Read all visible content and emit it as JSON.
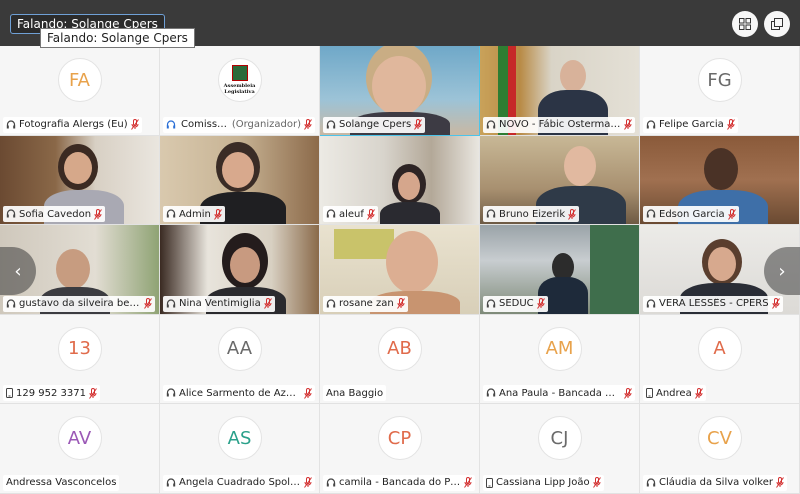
{
  "topbar": {
    "speaking": "Falando: Solange Cpers",
    "tooltip": "Falando: Solange Cpers"
  },
  "nav": {
    "prev_icon": "chevron-left-icon",
    "next_icon": "chevron-right-icon"
  },
  "colors": {
    "active_border": "#4cc4ea",
    "mic_muted": "#d32f2f",
    "topbar": "#3a3a3a"
  },
  "participants": [
    {
      "initials": "FA",
      "initials_color": "#e8a24b",
      "name": "Fotografia Alergs (Eu)",
      "device": "headset",
      "muted": true
    },
    {
      "name": "Comissão ...",
      "role": "(Organizador)",
      "device": "headset-sync",
      "muted": true,
      "logo_text": [
        "Assembleia",
        "Legislativa"
      ]
    },
    {
      "name": "Solange Cpers",
      "device": "headset",
      "muted": true,
      "active": true
    },
    {
      "name": "NOVO - Fábic Ostermann",
      "device": "headset",
      "muted": true
    },
    {
      "initials": "FG",
      "initials_color": "#6a6a6a",
      "name": "Felipe Garcia",
      "device": "headset",
      "muted": true
    },
    {
      "name": "Sofia Cavedon",
      "device": "headset",
      "muted": true
    },
    {
      "name": "Admin",
      "device": "headset",
      "muted": true
    },
    {
      "name": "aleuf",
      "device": "headset",
      "muted": true
    },
    {
      "name": "Bruno Eizerik",
      "device": "headset",
      "muted": true
    },
    {
      "name": "Edson Garcia",
      "device": "headset",
      "muted": true
    },
    {
      "name": "gustavo da silveira becker",
      "device": "headset",
      "muted": true
    },
    {
      "name": "Nina Ventimiglia",
      "device": "headset",
      "muted": true
    },
    {
      "name": "rosane zan",
      "device": "headset",
      "muted": true
    },
    {
      "name": "SEDUC",
      "device": "headset",
      "muted": true
    },
    {
      "name": "VERA LESSÊS - CPERS",
      "device": "headset",
      "muted": true
    },
    {
      "initials": "13",
      "initials_color": "#e06b4b",
      "name": "129 952 3371",
      "device": "phone",
      "muted": true
    },
    {
      "initials": "AA",
      "initials_color": "#6a6a6a",
      "name": "Alice Sarmento de Azeve...",
      "device": "headset",
      "muted": true
    },
    {
      "initials": "AB",
      "initials_color": "#e06b4b",
      "name": "Ana Baggio",
      "device": "none",
      "muted": false
    },
    {
      "initials": "AM",
      "initials_color": "#e8a24b",
      "name": "Ana Paula - Bancada MDB",
      "device": "headset",
      "muted": true
    },
    {
      "initials": "A",
      "initials_color": "#e06b4b",
      "name": "Andrea",
      "device": "phone",
      "muted": true
    },
    {
      "initials": "AV",
      "initials_color": "#9b59b6",
      "name": "Andressa Vasconcelos",
      "device": "none",
      "muted": false
    },
    {
      "initials": "AS",
      "initials_color": "#2aa08a",
      "name": "Angela Cuadrado Spolid...",
      "device": "headset",
      "muted": true
    },
    {
      "initials": "CP",
      "initials_color": "#e06b4b",
      "name": "camila - Bancada do Pro...",
      "device": "headset",
      "muted": true
    },
    {
      "initials": "CJ",
      "initials_color": "#6a6a6a",
      "name": "Cassiana Lipp João",
      "device": "phone",
      "muted": true
    },
    {
      "initials": "CV",
      "initials_color": "#e8a24b",
      "name": "Cláudia da Silva volker",
      "device": "headset",
      "muted": true
    }
  ]
}
